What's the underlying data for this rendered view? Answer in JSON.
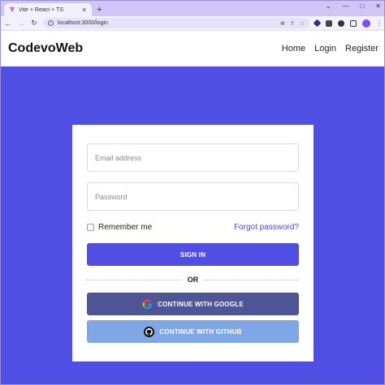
{
  "browser": {
    "tab_title": "Vite + React + TS",
    "new_tab_symbol": "+",
    "url": "localhost:3000/login",
    "window_controls": [
      "⌄",
      "—",
      "□",
      "✕"
    ]
  },
  "header": {
    "brand": "CodevoWeb",
    "nav": [
      "Home",
      "Login",
      "Register"
    ]
  },
  "form": {
    "email_placeholder": "Email address",
    "password_placeholder": "Password",
    "remember_label": "Remember me",
    "forgot_label": "Forgot password?",
    "signin_label": "SIGN IN",
    "or_label": "OR",
    "google_label": "CONTINUE WITH GOOGLE",
    "github_label": "CONTINUE WITH GITHUB"
  },
  "colors": {
    "hero_bg": "#4f4fe3",
    "signin_bg": "#4f4fe3",
    "google_bg": "#4d5597",
    "github_bg": "#7fa7e6",
    "link": "#4a4ad8"
  },
  "icons": {
    "google": "google-logo-icon",
    "github": "github-logo-icon"
  }
}
